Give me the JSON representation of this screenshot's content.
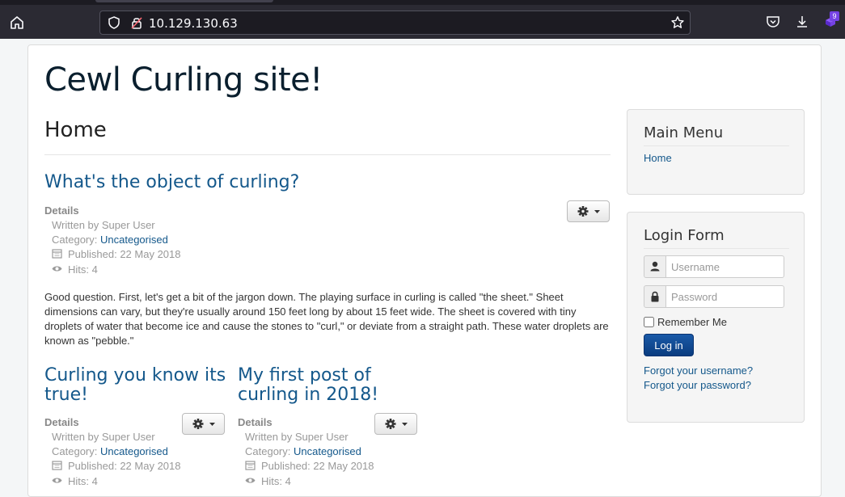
{
  "browser": {
    "url": "10.129.130.63",
    "extension_badge": "9"
  },
  "site": {
    "title": "Cewl Curling site!",
    "page_heading": "Home"
  },
  "articles": [
    {
      "title": "What's the object of curling?",
      "details_label": "Details",
      "author": "Written by Super User",
      "category_label": "Category:",
      "category": "Uncategorised",
      "published": "Published: 22 May 2018",
      "hits": "Hits: 4",
      "intro": "Good question. First, let's get a bit of the jargon down. The playing surface in curling is called \"the sheet.\" Sheet dimensions can vary, but they're usually around 150 feet long by about 15 feet wide. The sheet is covered with tiny droplets of water that become ice and cause the stones to \"curl,\" or deviate from a straight path. These water droplets are known as \"pebble.\""
    },
    {
      "title": "Curling you know its true!",
      "details_label": "Details",
      "author": "Written by Super User",
      "category_label": "Category:",
      "category": "Uncategorised",
      "published": "Published: 22 May 2018",
      "hits": "Hits: 4"
    },
    {
      "title": "My first post of curling in 2018!",
      "details_label": "Details",
      "author": "Written by Super User",
      "category_label": "Category:",
      "category": "Uncategorised",
      "published": "Published: 22 May 2018",
      "hits": "Hits: 4"
    }
  ],
  "sidebar": {
    "main_menu": {
      "title": "Main Menu",
      "items": [
        "Home"
      ]
    },
    "login": {
      "title": "Login Form",
      "username_placeholder": "Username",
      "password_placeholder": "Password",
      "remember_label": "Remember Me",
      "button_label": "Log in",
      "forgot_username": "Forgot your username?",
      "forgot_password": "Forgot your password?"
    }
  },
  "colors": {
    "link": "#14588b",
    "button_primary": "#0a3c7f",
    "browser_chrome": "#2b2a33"
  }
}
